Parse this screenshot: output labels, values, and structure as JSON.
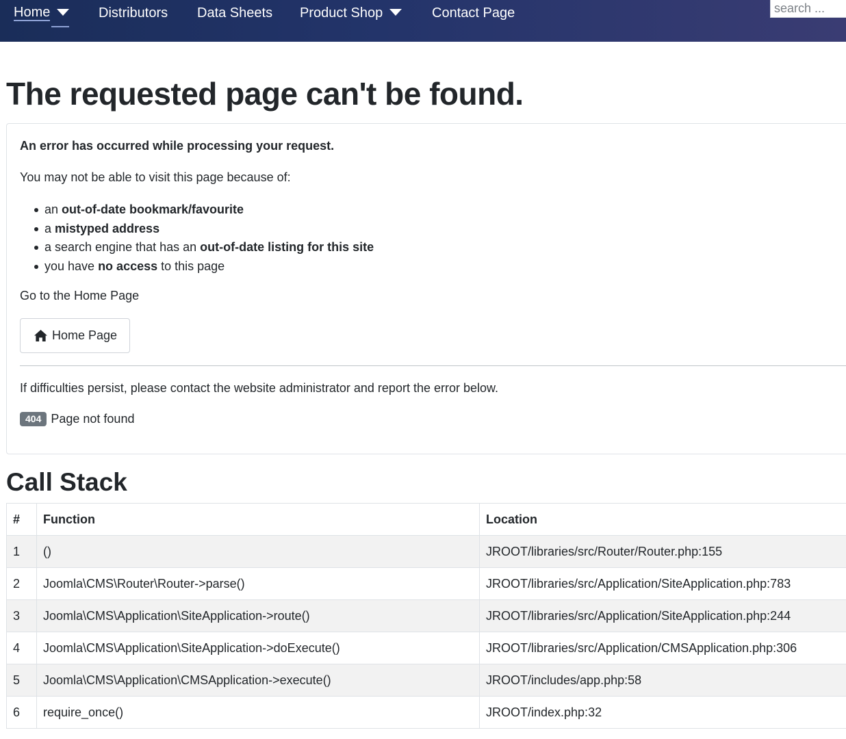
{
  "nav": {
    "items": [
      {
        "label": "Home",
        "has_dropdown": true,
        "active": true
      },
      {
        "label": "Distributors",
        "has_dropdown": false
      },
      {
        "label": "Data Sheets",
        "has_dropdown": false
      },
      {
        "label": "Product Shop",
        "has_dropdown": true
      },
      {
        "label": "Contact Page",
        "has_dropdown": false
      }
    ],
    "search_placeholder": "search ..."
  },
  "page_title": "The requested page can't be found.",
  "error": {
    "heading": "An error has occurred while processing your request.",
    "intro": "You may not be able to visit this page because of:",
    "reasons": [
      {
        "pre": "an ",
        "bold": "out-of-date bookmark/favourite",
        "post": ""
      },
      {
        "pre": "a ",
        "bold": "mistyped address",
        "post": ""
      },
      {
        "pre": "a search engine that has an ",
        "bold": "out-of-date listing for this site",
        "post": ""
      },
      {
        "pre": "you have ",
        "bold": "no access",
        "post": " to this page"
      }
    ],
    "goto_text": "Go to the Home Page",
    "home_button_label": "Home Page",
    "persist_text": "If difficulties persist, please contact the website administrator and report the error below.",
    "code": "404",
    "code_message": "Page not found"
  },
  "call_stack": {
    "title": "Call Stack",
    "headers": [
      "#",
      "Function",
      "Location"
    ],
    "rows": [
      [
        "1",
        "()",
        "JROOT/libraries/src/Router/Router.php:155"
      ],
      [
        "2",
        "Joomla\\CMS\\Router\\Router->parse()",
        "JROOT/libraries/src/Application/SiteApplication.php:783"
      ],
      [
        "3",
        "Joomla\\CMS\\Application\\SiteApplication->route()",
        "JROOT/libraries/src/Application/SiteApplication.php:244"
      ],
      [
        "4",
        "Joomla\\CMS\\Application\\SiteApplication->doExecute()",
        "JROOT/libraries/src/Application/CMSApplication.php:306"
      ],
      [
        "5",
        "Joomla\\CMS\\Application\\CMSApplication->execute()",
        "JROOT/includes/app.php:58"
      ],
      [
        "6",
        "require_once()",
        "JROOT/index.php:32"
      ]
    ]
  }
}
